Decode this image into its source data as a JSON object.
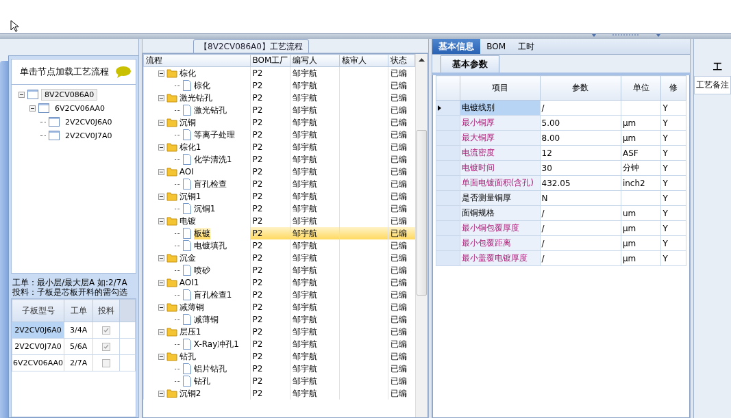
{
  "left_panel": {
    "hint": "单击节点加载工艺流程",
    "tree": [
      {
        "label": "8V2CV086A0",
        "selected": true,
        "expanded": true,
        "children": [
          {
            "label": "6V2CV06AA0",
            "selected": false,
            "expanded": true,
            "children": [
              {
                "label": "2V2CV0J6A0",
                "selected": false
              },
              {
                "label": "2V2CV0J7A0",
                "selected": false
              }
            ]
          }
        ]
      }
    ],
    "notes": [
      "工单：最小层/最大层A 如:2/7A",
      "投料：子板是芯板开料的需勾选"
    ],
    "table": {
      "columns": [
        "子板型号",
        "工单",
        "投料"
      ],
      "rows": [
        {
          "board": "2V2CV0J6A0",
          "order": "3/4A",
          "checked": true,
          "selected": true
        },
        {
          "board": "2V2CV0J7A0",
          "order": "5/6A",
          "checked": true,
          "selected": false
        },
        {
          "board": "6V2CV06AA0",
          "order": "2/7A",
          "checked": false,
          "selected": false
        }
      ]
    }
  },
  "process_panel": {
    "title": "【8V2CV086A0】工艺流程",
    "columns": [
      "流程",
      "BOM工厂",
      "编写人",
      "核审人",
      "状态"
    ],
    "rows": [
      {
        "name": "棕化",
        "factory": "P2",
        "author": "邹宇航",
        "status": "已编",
        "selected": false,
        "expanded": true,
        "children": [
          {
            "name": "棕化",
            "factory": "P2",
            "author": "邹宇航",
            "status": "已编",
            "selected": false
          }
        ]
      },
      {
        "name": "激光钻孔",
        "factory": "P2",
        "author": "邹宇航",
        "status": "已编",
        "selected": false,
        "expanded": true,
        "children": [
          {
            "name": "激光钻孔",
            "factory": "P2",
            "author": "邹宇航",
            "status": "已编",
            "selected": false
          }
        ]
      },
      {
        "name": "沉铜",
        "factory": "P2",
        "author": "邹宇航",
        "status": "已编",
        "selected": false,
        "expanded": true,
        "children": [
          {
            "name": "等离子处理",
            "factory": "P2",
            "author": "邹宇航",
            "status": "已编",
            "selected": false
          }
        ]
      },
      {
        "name": "棕化1",
        "factory": "P2",
        "author": "邹宇航",
        "status": "已编",
        "selected": false,
        "expanded": true,
        "children": [
          {
            "name": "化学清洗1",
            "factory": "P2",
            "author": "邹宇航",
            "status": "已编",
            "selected": false
          }
        ]
      },
      {
        "name": "AOI",
        "factory": "P2",
        "author": "邹宇航",
        "status": "已编",
        "selected": false,
        "expanded": true,
        "children": [
          {
            "name": "盲孔检查",
            "factory": "P2",
            "author": "邹宇航",
            "status": "已编",
            "selected": false
          }
        ]
      },
      {
        "name": "沉铜1",
        "factory": "P2",
        "author": "邹宇航",
        "status": "已编",
        "selected": false,
        "expanded": true,
        "children": [
          {
            "name": "沉铜1",
            "factory": "P2",
            "author": "邹宇航",
            "status": "已编",
            "selected": false
          }
        ]
      },
      {
        "name": "电镀",
        "factory": "P2",
        "author": "邹宇航",
        "status": "已编",
        "selected": false,
        "expanded": true,
        "children": [
          {
            "name": "板镀",
            "factory": "P2",
            "author": "邹宇航",
            "status": "已编",
            "selected": true
          },
          {
            "name": "电镀填孔",
            "factory": "P2",
            "author": "邹宇航",
            "status": "已编",
            "selected": false
          }
        ]
      },
      {
        "name": "沉金",
        "factory": "P2",
        "author": "邹宇航",
        "status": "已编",
        "selected": false,
        "expanded": true,
        "children": [
          {
            "name": "喷砂",
            "factory": "P2",
            "author": "邹宇航",
            "status": "已编",
            "selected": false
          }
        ]
      },
      {
        "name": "AOI1",
        "factory": "P2",
        "author": "邹宇航",
        "status": "已编",
        "selected": false,
        "expanded": true,
        "children": [
          {
            "name": "盲孔检查1",
            "factory": "P2",
            "author": "邹宇航",
            "status": "已编",
            "selected": false
          }
        ]
      },
      {
        "name": "减薄铜",
        "factory": "P2",
        "author": "邹宇航",
        "status": "已编",
        "selected": false,
        "expanded": true,
        "children": [
          {
            "name": "减薄铜",
            "factory": "P2",
            "author": "邹宇航",
            "status": "已编",
            "selected": false
          }
        ]
      },
      {
        "name": "层压1",
        "factory": "P2",
        "author": "邹宇航",
        "status": "已编",
        "selected": false,
        "expanded": true,
        "children": [
          {
            "name": "X-Ray冲孔1",
            "factory": "P2",
            "author": "邹宇航",
            "status": "已编",
            "selected": false
          }
        ]
      },
      {
        "name": "钻孔",
        "factory": "P2",
        "author": "邹宇航",
        "status": "已编",
        "selected": false,
        "expanded": true,
        "children": [
          {
            "name": "铝片钻孔",
            "factory": "P2",
            "author": "邹宇航",
            "status": "已编",
            "selected": false
          },
          {
            "name": "钻孔",
            "factory": "P2",
            "author": "邹宇航",
            "status": "已编",
            "selected": false
          }
        ]
      },
      {
        "name": "沉铜2",
        "factory": "P2",
        "author": "邹宇航",
        "status": "已编",
        "selected": false,
        "expanded": true
      }
    ]
  },
  "detail_panel": {
    "tabs": [
      {
        "label": "基本信息",
        "selected": true
      },
      {
        "label": "BOM",
        "selected": false
      },
      {
        "label": "工时",
        "selected": false
      }
    ],
    "subtab": "基本参数",
    "columns": [
      "项目",
      "参数",
      "单位",
      "修"
    ],
    "rows": [
      {
        "item": "电镀线别",
        "value": "/",
        "unit": "",
        "modified": "Y",
        "required": false,
        "selected": true
      },
      {
        "item": "最小铜厚",
        "value": "5.00",
        "unit": "μm",
        "modified": "Y",
        "required": true,
        "selected": false
      },
      {
        "item": "最大铜厚",
        "value": "8.00",
        "unit": "μm",
        "modified": "Y",
        "required": true,
        "selected": false
      },
      {
        "item": "电流密度",
        "value": "12",
        "unit": "ASF",
        "modified": "Y",
        "required": true,
        "selected": false
      },
      {
        "item": "电镀时间",
        "value": "30",
        "unit": "分钟",
        "modified": "Y",
        "required": true,
        "selected": false
      },
      {
        "item": "单面电镀面积(含孔)",
        "value": "432.05",
        "unit": "inch2",
        "modified": "Y",
        "required": true,
        "selected": false
      },
      {
        "item": "是否测量铜厚",
        "value": "N",
        "unit": "",
        "modified": "Y",
        "required": false,
        "selected": false
      },
      {
        "item": "面铜规格",
        "value": "/",
        "unit": "um",
        "modified": "Y",
        "required": false,
        "selected": false
      },
      {
        "item": "最小铜包覆厚度",
        "value": "/",
        "unit": "μm",
        "modified": "Y",
        "required": true,
        "selected": false
      },
      {
        "item": "最小包覆距离",
        "value": "/",
        "unit": "μm",
        "modified": "Y",
        "required": true,
        "selected": false
      },
      {
        "item": "最小盖覆电镀厚度",
        "value": "/",
        "unit": "μm",
        "modified": "Y",
        "required": true,
        "selected": false
      }
    ]
  },
  "remarks_panel": {
    "tab": "工",
    "label": "工艺备注"
  }
}
